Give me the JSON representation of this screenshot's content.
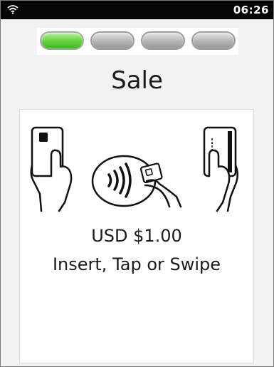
{
  "status_bar": {
    "time": "06:26",
    "icons": [
      "wifi-icon"
    ]
  },
  "progress": {
    "steps_total": 4,
    "steps_completed": 1,
    "active_color": "#5cc93a",
    "inactive_color": "#b0b0b0"
  },
  "screen": {
    "title": "Sale"
  },
  "payment": {
    "amount": "USD $1.00",
    "prompt": "Insert, Tap or Swipe",
    "illustrations": [
      "insert-card-icon",
      "contactless-tap-icon",
      "swipe-card-icon"
    ]
  }
}
